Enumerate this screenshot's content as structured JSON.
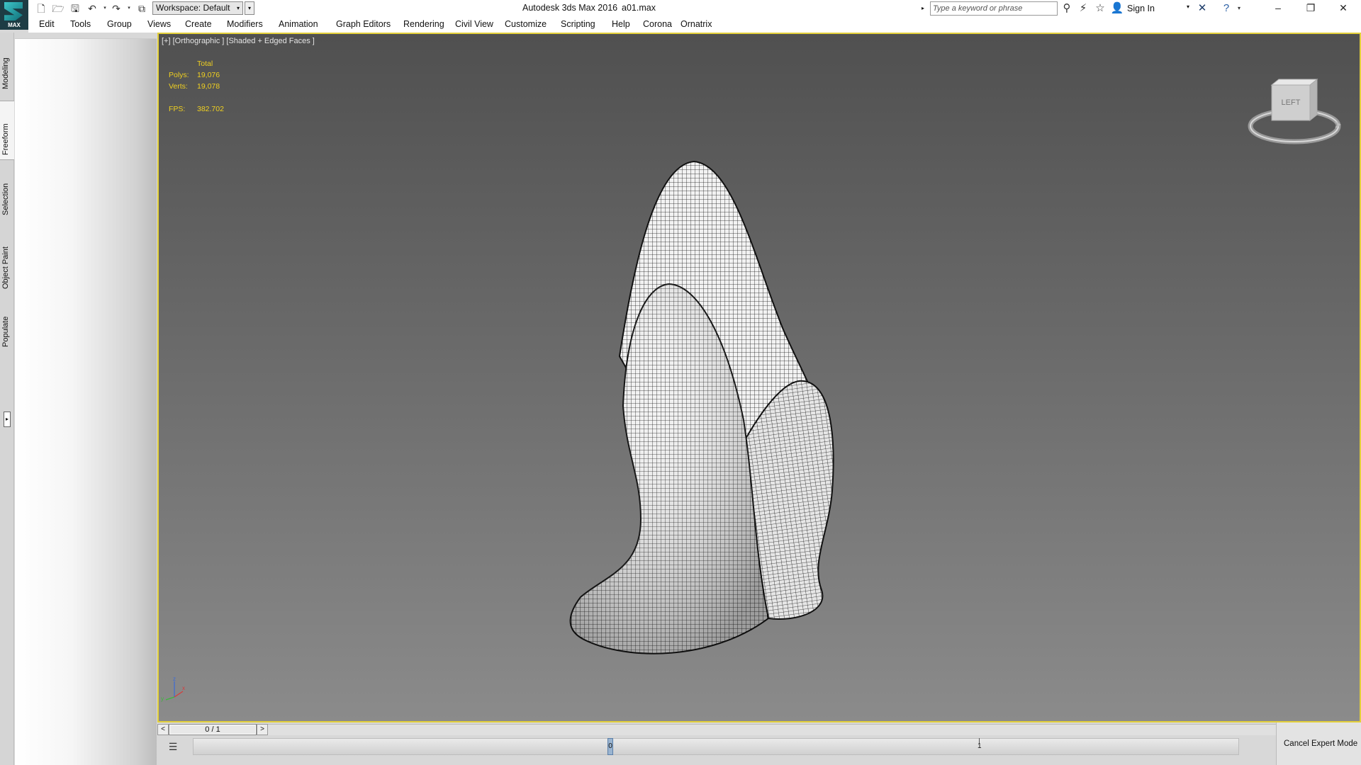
{
  "titlebar": {
    "logo_text": "MAX",
    "workspace": "Workspace: Default",
    "app_title": "Autodesk 3ds Max 2016",
    "file_name": "a01.max",
    "search_placeholder": "Type a keyword or phrase",
    "signin_label": "Sign In"
  },
  "menus": [
    "Edit",
    "Tools",
    "Group",
    "Views",
    "Create",
    "Modifiers",
    "Animation",
    "Graph Editors",
    "Rendering",
    "Civil View",
    "Customize",
    "Scripting",
    "Help",
    "Corona",
    "Ornatrix"
  ],
  "ribbon_tabs": [
    "Modeling",
    "Freeform",
    "Selection",
    "Object Paint",
    "Populate"
  ],
  "active_ribbon_tab": "Freeform",
  "viewport": {
    "label": "[+] [Orthographic ] [Shaded + Edged Faces ]",
    "stats": {
      "header": "Total",
      "polys_label": "Polys:",
      "polys": "19,076",
      "verts_label": "Verts:",
      "verts": "19,078",
      "fps_label": "FPS:",
      "fps": "382.702"
    },
    "viewcube_face": "LEFT",
    "axis": {
      "z": "z",
      "x": "x",
      "y": "y"
    },
    "border_color": "#e2cf3a",
    "stats_color": "#f0d020"
  },
  "timeline": {
    "prev": "<",
    "slider": "0 / 1",
    "next": ">",
    "marker": "0",
    "tick": "1"
  },
  "expert_mode_label": "Cancel Expert Mode"
}
